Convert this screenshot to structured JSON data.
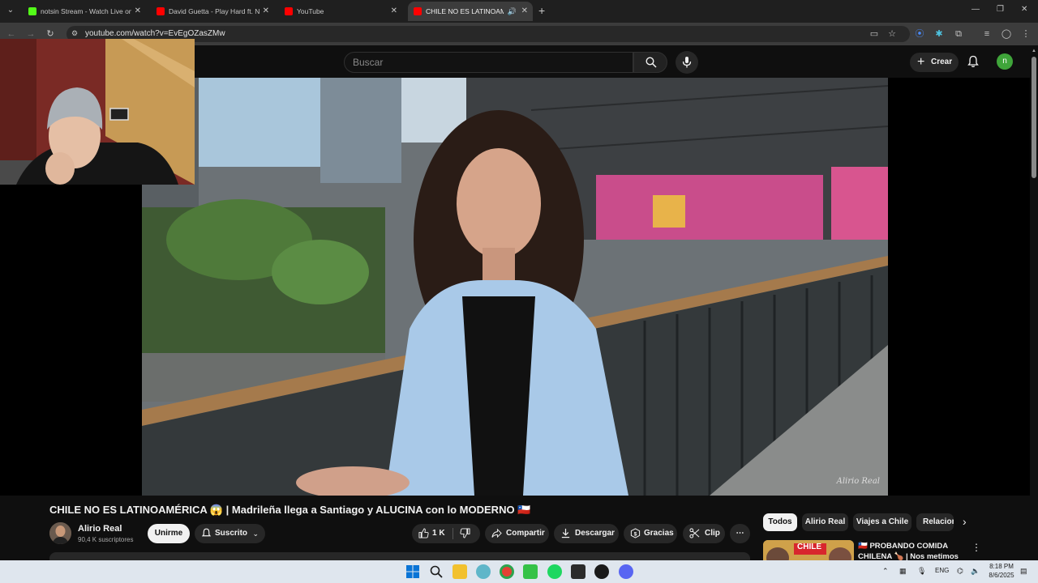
{
  "browser": {
    "tabs": [
      {
        "title": "notsin Stream - Watch Live on K",
        "favicon_color": "#53fc18",
        "active": false
      },
      {
        "title": "David Guetta - Play Hard ft. Ne",
        "favicon_color": "#ff0000",
        "active": false
      },
      {
        "title": "YouTube",
        "favicon_color": "#ff0000",
        "active": false
      },
      {
        "title": "CHILE NO ES LATINOAMÉRICA",
        "favicon_color": "#ff0000",
        "active": true
      }
    ],
    "url": "youtube.com/watch?v=EvEgOZasZMw"
  },
  "masthead": {
    "search_placeholder": "Buscar",
    "create_label": "Crear",
    "account_initial": "n",
    "account_color": "#3fa53a"
  },
  "video": {
    "watermark": "Alirio Real",
    "title": "CHILE NO ES LATINOAMÉRICA 😱 | Madrileña llega a Santiago y ALUCINA con lo MODERNO 🇨🇱",
    "channel": {
      "name": "Alirio Real",
      "subscribers": "90,4 K suscriptores"
    },
    "join_label": "Unirme",
    "subscribed_label": "Suscrito",
    "likes": "1 K",
    "actions": {
      "share": "Compartir",
      "download": "Descargar",
      "thanks": "Gracias",
      "clip": "Clip"
    }
  },
  "sidebar": {
    "chips": [
      "Todos",
      "Alirio Real",
      "Viajes a Chile",
      "Relacion"
    ],
    "recommendation": {
      "title": "🇨🇱 PROBANDO COMIDA CHILENA 🍗 | Nos metimos e...",
      "thumb_text": "CHILE"
    }
  },
  "taskbar": {
    "language": "ENG",
    "time": "8:18 PM",
    "date": "8/6/2025"
  }
}
